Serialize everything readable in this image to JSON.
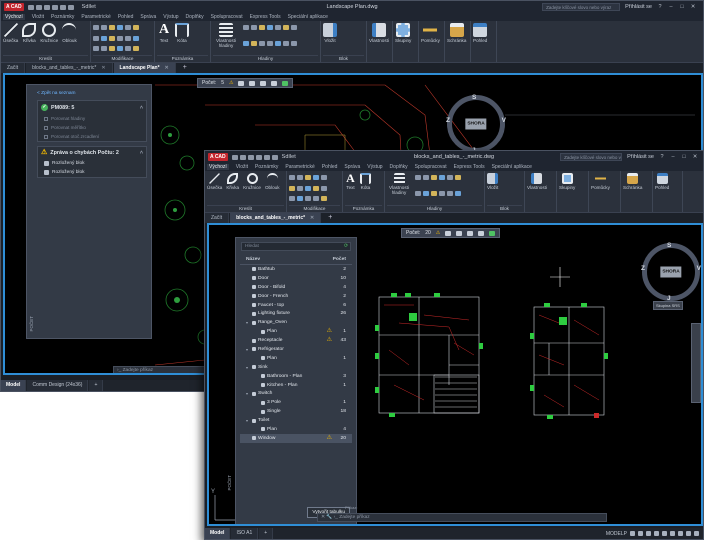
{
  "win1": {
    "title": "Landscape Plan.dwg",
    "search_placeholder": "Zadejte klíčové slovo nebo výraz",
    "user": "Přihlásit se",
    "share": "Sdílet",
    "menu": [
      "Výchozí",
      "Vložit",
      "Poznámky",
      "Parametrické",
      "Pohled",
      "Správa",
      "Výstup",
      "Doplňky",
      "Spolupracovat",
      "Express Tools",
      "Speciální aplikace"
    ],
    "ribbon": {
      "draw_tools": [
        "Úsečka",
        "Křivka",
        "Kružnice",
        "Oblouk"
      ],
      "draw_group": "Kreslit",
      "modify_group": "Modifikace",
      "annot_tools": [
        "Text",
        "Kóta"
      ],
      "annot_group": "Poznámka",
      "layer_tool": "Vlastnosti hladiny",
      "layer_group": "Hladiny",
      "insert_tool": "Vložit",
      "block_group": "Blok",
      "props_tool": "Vlastnosti",
      "groups_tool": "Skupiny",
      "utils_tool": "Pomůcky",
      "clip_tool": "Schránka",
      "view_tool": "Pohled"
    },
    "tabs": [
      "Začít",
      "blocks_and_tables_-_metric*",
      "Landscape Plan*"
    ],
    "count_bar": {
      "label": "Počet:",
      "value": "5"
    },
    "panel": {
      "back": "< Zpět na seznam",
      "card1_title": "PM089: 5",
      "options": [
        "Porovnat hladiny",
        "Porovnat měřítko",
        "Porovnat otoč.zrcadlení"
      ],
      "card2_title": "Zpráva o chybách Počtu: 2",
      "blocks": [
        "Rozložený blok",
        "Rozložený blok"
      ],
      "vertical_label": "POČET"
    },
    "viewcube": {
      "face": "SHORA",
      "n": "S",
      "s": "J",
      "w": "Z",
      "e": "V"
    },
    "status_tabs": [
      "Model",
      "Comm Design (24x36)"
    ],
    "cmd_placeholder": "Zadejte příkaz"
  },
  "win2": {
    "title": "blocks_and_tables_-_metric.dwg",
    "search_placeholder": "Zadejte klíčové slovo nebo výraz",
    "user": "Přihlásit se",
    "share": "Sdílet",
    "menu": [
      "Výchozí",
      "Vložit",
      "Poznámky",
      "Parametrické",
      "Pohled",
      "Správa",
      "Výstup",
      "Doplňky",
      "Spolupracovat",
      "Express Tools",
      "Speciální aplikace"
    ],
    "ribbon": {
      "draw_tools": [
        "Úsečka",
        "Křivka",
        "Kružnice",
        "Oblouk"
      ],
      "draw_group": "Kreslit",
      "modify_group": "Modifikace",
      "annot_tools": [
        "Text",
        "Kóta"
      ],
      "annot_group": "Poznámka",
      "layer_tool": "Vlastnosti hladiny",
      "layer_group": "Hladiny",
      "insert_tool": "Vložit",
      "block_group": "Blok",
      "props_tool": "Vlastnosti",
      "groups_tool": "Skupiny",
      "utils_tool": "Pomůcky",
      "clip_tool": "Schránka",
      "view_tool": "Pohled"
    },
    "tabs": [
      "Začít",
      "blocks_and_tables_-_metric*"
    ],
    "count_bar": {
      "label": "Počet:",
      "value": "20"
    },
    "list": {
      "filter_placeholder": "Hledat",
      "col_name": "Název",
      "col_count": "Počet",
      "rows": [
        {
          "name": "Bathtub",
          "count": "2"
        },
        {
          "name": "Door",
          "count": "10"
        },
        {
          "name": "Door - Bifold",
          "count": "4"
        },
        {
          "name": "Door - French",
          "count": "2"
        },
        {
          "name": "Faucet - top",
          "count": "6"
        },
        {
          "name": "Lighting fixture",
          "count": "26"
        },
        {
          "name": "Range_Oven",
          "count": ""
        },
        {
          "name": "Plan",
          "count": "1"
        },
        {
          "name": "Receptacle",
          "count": "43"
        },
        {
          "name": "Refrigerator",
          "count": ""
        },
        {
          "name": "Plan",
          "count": "1"
        },
        {
          "name": "Sink",
          "count": ""
        },
        {
          "name": "Bathroom - Plan",
          "count": "3"
        },
        {
          "name": "Kitchen - Plan",
          "count": "1"
        },
        {
          "name": "Switch",
          "count": ""
        },
        {
          "name": "3 Pole",
          "count": "1"
        },
        {
          "name": "Single",
          "count": "18"
        },
        {
          "name": "Toilet",
          "count": ""
        },
        {
          "name": "Plan",
          "count": "4"
        },
        {
          "name": "Window",
          "count": "20"
        }
      ],
      "table_button": "Vytvořit tabulku",
      "vertical_label": "POČET"
    },
    "viewcube": {
      "face": "SHORA",
      "n": "S",
      "s": "J",
      "w": "Z",
      "e": "V"
    },
    "wcs": "Skupina SRS",
    "status_tabs": [
      "Model",
      "ISO A1"
    ],
    "cmd_placeholder": "Zadejte příkaz",
    "modelp": "MODELP",
    "cmd_history": "Příkaz:"
  }
}
